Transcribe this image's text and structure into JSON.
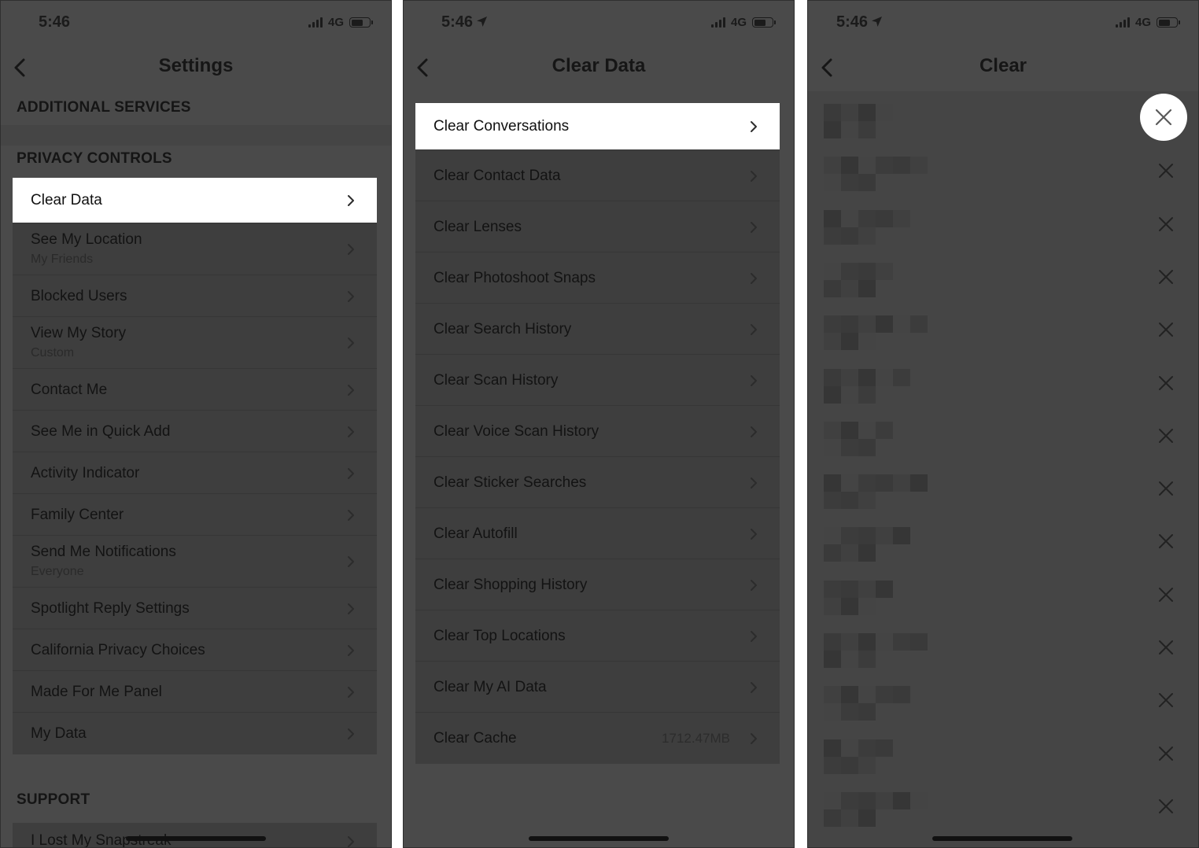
{
  "status_bar": {
    "time": "5:46",
    "network": "4G",
    "battery_level": 0.65
  },
  "screens": [
    {
      "title": "Settings",
      "section_top": "ADDITIONAL SERVICES",
      "section_privacy": "PRIVACY CONTROLS",
      "items": [
        {
          "label": "Clear Data",
          "highlighted": true
        },
        {
          "label": "See My Location",
          "subtitle": "My Friends"
        },
        {
          "label": "Blocked Users"
        },
        {
          "label": "View My Story",
          "subtitle": "Custom"
        },
        {
          "label": "Contact Me"
        },
        {
          "label": "See Me in Quick Add"
        },
        {
          "label": "Activity Indicator"
        },
        {
          "label": "Family Center"
        },
        {
          "label": "Send Me Notifications",
          "subtitle": "Everyone"
        },
        {
          "label": "Spotlight Reply Settings"
        },
        {
          "label": "California Privacy Choices"
        },
        {
          "label": "Made For Me Panel"
        },
        {
          "label": "My Data"
        }
      ],
      "section_support": "SUPPORT",
      "support_items": [
        {
          "label": "I Lost My Snapstreak"
        }
      ]
    },
    {
      "title": "Clear Data",
      "items": [
        {
          "label": "Clear Conversations",
          "highlighted": true
        },
        {
          "label": "Clear Contact Data"
        },
        {
          "label": "Clear Lenses"
        },
        {
          "label": "Clear Photoshoot Snaps"
        },
        {
          "label": "Clear Search History"
        },
        {
          "label": "Clear Scan History"
        },
        {
          "label": "Clear Voice Scan History"
        },
        {
          "label": "Clear Sticker Searches"
        },
        {
          "label": "Clear Autofill"
        },
        {
          "label": "Clear Shopping History"
        },
        {
          "label": "Clear Top Locations"
        },
        {
          "label": "Clear My AI Data"
        },
        {
          "label": "Clear Cache",
          "value": "1712.47MB"
        }
      ]
    },
    {
      "title": "Clear",
      "conversation_count": 14,
      "highlighted_index": 0
    }
  ],
  "icons": {
    "back": "chevron-left-icon",
    "row": "chevron-right-icon",
    "remove": "close-icon",
    "location": "location-arrow-icon"
  },
  "colors": {
    "dim_overlay": "#4a4a4a",
    "highlight": "#ffffff"
  }
}
